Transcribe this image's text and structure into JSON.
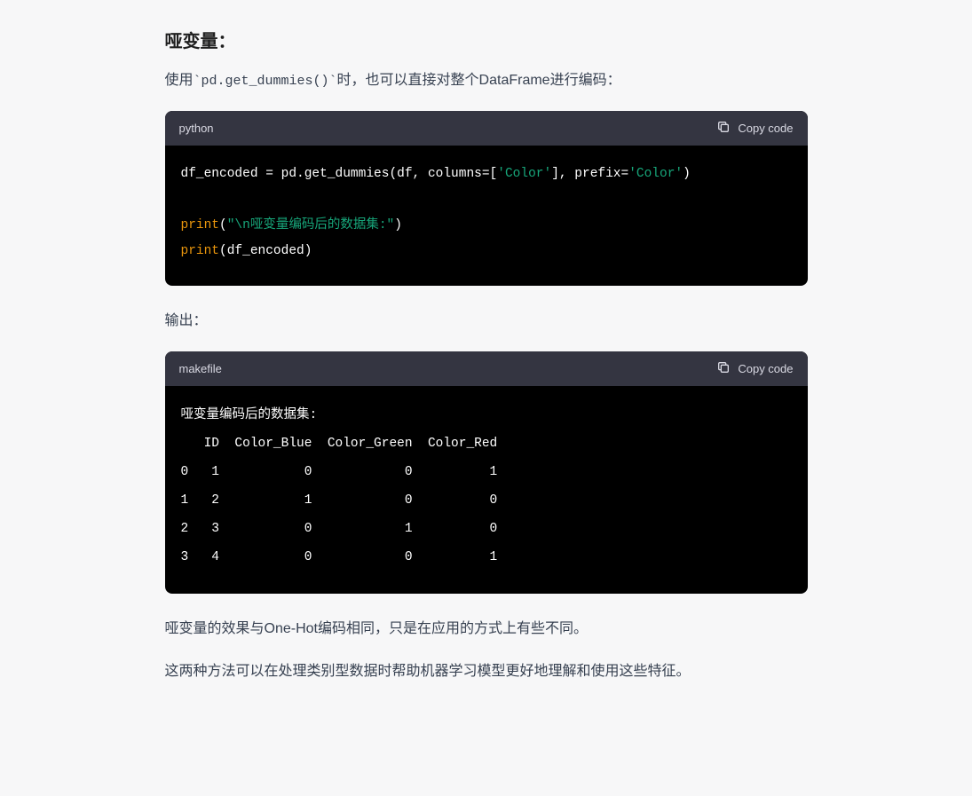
{
  "heading": "哑变量：",
  "intro_pre": "使用",
  "intro_code": "`pd.get_dummies()`",
  "intro_post": "时，也可以直接对整个DataFrame进行编码：",
  "copy_label": "Copy code",
  "block1": {
    "lang": "python",
    "line1a": "df_encoded = pd.get_dummies(df, columns=[",
    "line1b": "'Color'",
    "line1c": "], prefix=",
    "line1d": "'Color'",
    "line1e": ")",
    "line2a": "print",
    "line2b": "(",
    "line2c": "\"\\n哑变量编码后的数据集:\"",
    "line2d": ")",
    "line3a": "print",
    "line3b": "(df_encoded)"
  },
  "output_label": "输出：",
  "block2": {
    "lang": "makefile",
    "text": "哑变量编码后的数据集:\n   ID  Color_Blue  Color_Green  Color_Red\n0   1           0            0          1\n1   2           1            0          0\n2   3           0            1          0\n3   4           0            0          1"
  },
  "para2": "哑变量的效果与One-Hot编码相同，只是在应用的方式上有些不同。",
  "para3": "这两种方法可以在处理类别型数据时帮助机器学习模型更好地理解和使用这些特征。"
}
